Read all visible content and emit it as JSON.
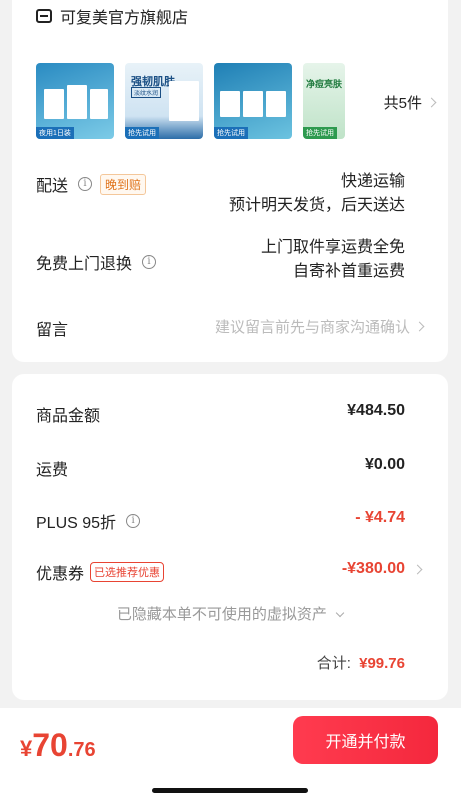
{
  "store": {
    "name": "可复美官方旗舰店",
    "thumbnails": [
      {
        "tag": "夜用1日装"
      },
      {
        "title": "强韧肌肤",
        "sub": "淡纹水润",
        "tag": "抢先试用"
      },
      {
        "tag": "抢先试用"
      },
      {
        "title": "净痘亮肤",
        "tag": "抢先试用"
      }
    ],
    "more_label": "共5件"
  },
  "delivery": {
    "label": "配送",
    "badge": "晚到赔",
    "method": "快递运输",
    "estimate": "预计明天发货，后天送达"
  },
  "returns": {
    "label": "免费上门退换",
    "line1": "上门取件享运费全免",
    "line2": "自寄补首重运费"
  },
  "remark": {
    "label": "留言",
    "placeholder": "建议留言前先与商家沟通确认"
  },
  "pricing": {
    "goods_label": "商品金额",
    "goods_value": "¥484.50",
    "shipping_label": "运费",
    "shipping_value": "¥0.00",
    "plus_label": "PLUS 95折",
    "plus_value": "- ¥4.74",
    "coupon_label": "优惠券",
    "coupon_badge": "已选推荐优惠",
    "coupon_value": "-¥380.00",
    "hidden_assets": "已隐藏本单不可使用的虚拟资产",
    "total_label": "合计:",
    "total_value": "¥99.76"
  },
  "pay": {
    "currency": "¥",
    "integer": "70",
    "decimal": ".76",
    "button": "开通并付款"
  },
  "colors": {
    "accent": "#e84433",
    "button": "#f4283d"
  }
}
